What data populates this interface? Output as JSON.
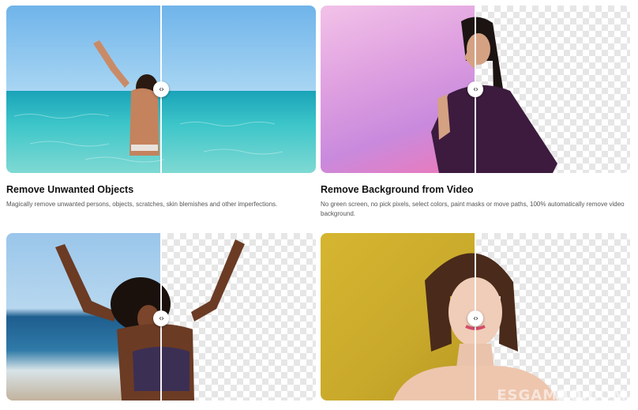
{
  "cards": [
    {
      "title": "Remove Unwanted Objects",
      "description": "Magically remove unwanted persons, objects, scratches, skin blemishes and other imperfections.",
      "image": "woman-in-sea-photo",
      "slider_position": 0.5
    },
    {
      "title": "Remove Background from Video",
      "description": "No green screen, no pick pixels, select colors, paint masks or move paths, 100% automatically remove video background.",
      "image": "woman-blowing-kiss-photo",
      "slider_position": 0.5
    },
    {
      "title": "",
      "description": "",
      "image": "woman-arms-raised-beach-photo",
      "slider_position": 0.5
    },
    {
      "title": "",
      "description": "",
      "image": "woman-portrait-yellow-photo",
      "slider_position": 0.5
    }
  ],
  "handle_icon": "chevron-left-right-icon",
  "handle_glyph": "‹›",
  "watermark": "ESGAMBO.COM"
}
